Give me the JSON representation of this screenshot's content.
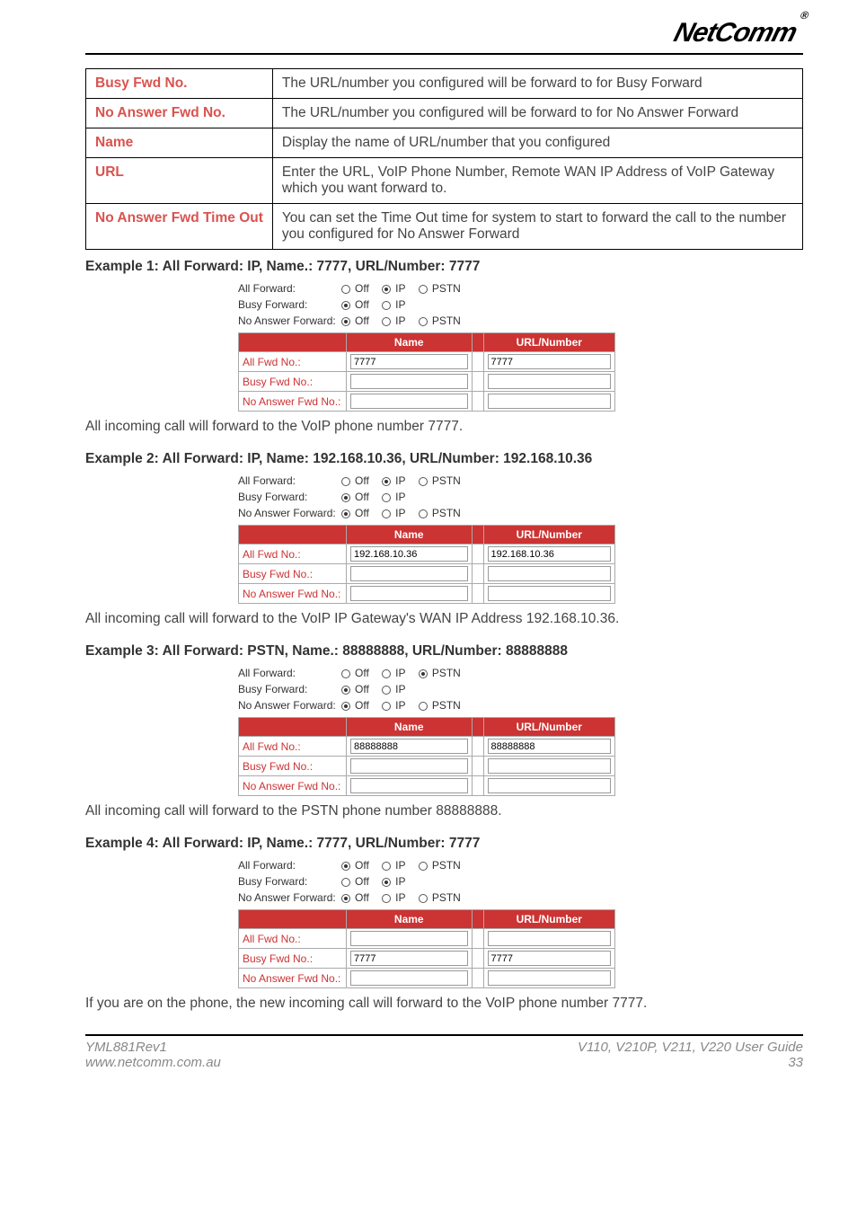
{
  "brand": "NetComm",
  "definitions": [
    {
      "key": "Busy Fwd No.",
      "desc": "The URL/number you configured will be forward to for Busy Forward"
    },
    {
      "key": "No Answer Fwd No.",
      "desc": "The URL/number you configured will be forward to for No Answer Forward"
    },
    {
      "key": "Name",
      "desc": "Display the name of URL/number that you configured"
    },
    {
      "key": "URL",
      "desc": "Enter the URL, VoIP Phone Number, Remote WAN IP Address of VoIP Gateway which you want forward to."
    },
    {
      "key": "No Answer Fwd Time Out",
      "desc": "You can set the Time Out time for system to start to forward the call to the number you configured for No Answer Forward"
    }
  ],
  "labels": {
    "all_forward": "All Forward:",
    "busy_forward": "Busy Forward:",
    "no_answer_forward": "No Answer Forward:",
    "off": "Off",
    "ip": "IP",
    "pstn": "PSTN",
    "name_col": "Name",
    "url_col": "URL/Number",
    "row_all": "All Fwd No.:",
    "row_busy": "Busy Fwd No.:",
    "row_noans": "No Answer Fwd No.:"
  },
  "examples": [
    {
      "title": "Example 1: All Forward: IP, Name.: 7777, URL/Number: 7777",
      "radios": {
        "all": "IP",
        "busy": "Off",
        "noans": "Off"
      },
      "all_name": "7777",
      "all_url": "7777",
      "busy_name": "",
      "busy_url": "",
      "noans_name": "",
      "noans_url": "",
      "desc": "All incoming call will forward to the VoIP phone number 7777."
    },
    {
      "title": "Example 2: All Forward: IP, Name: 192.168.10.36, URL/Number: 192.168.10.36",
      "radios": {
        "all": "IP",
        "busy": "Off",
        "noans": "Off"
      },
      "all_name": "192.168.10.36",
      "all_url": "192.168.10.36",
      "busy_name": "",
      "busy_url": "",
      "noans_name": "",
      "noans_url": "",
      "desc": "All incoming call will forward to the VoIP IP Gateway's WAN IP Address 192.168.10.36."
    },
    {
      "title": "Example 3: All Forward: PSTN, Name.: 88888888, URL/Number: 88888888",
      "radios": {
        "all": "PSTN",
        "busy": "Off",
        "noans": "Off"
      },
      "all_name": "88888888",
      "all_url": "88888888",
      "busy_name": "",
      "busy_url": "",
      "noans_name": "",
      "noans_url": "",
      "desc": "All incoming call will forward to the PSTN phone number 88888888."
    },
    {
      "title": "Example 4: All Forward: IP, Name.: 7777, URL/Number: 7777",
      "radios": {
        "all": "Off",
        "busy": "IP",
        "noans": "Off"
      },
      "all_name": "",
      "all_url": "",
      "busy_name": "7777",
      "busy_url": "7777",
      "noans_name": "",
      "noans_url": "",
      "desc": "If you are on the phone, the new incoming call will forward to the VoIP phone number 7777."
    }
  ],
  "footer": {
    "docref": "YML881Rev1",
    "url": "www.netcomm.com.au",
    "guide": "V110, V210P, V211, V220 User Guide",
    "page": "33"
  }
}
